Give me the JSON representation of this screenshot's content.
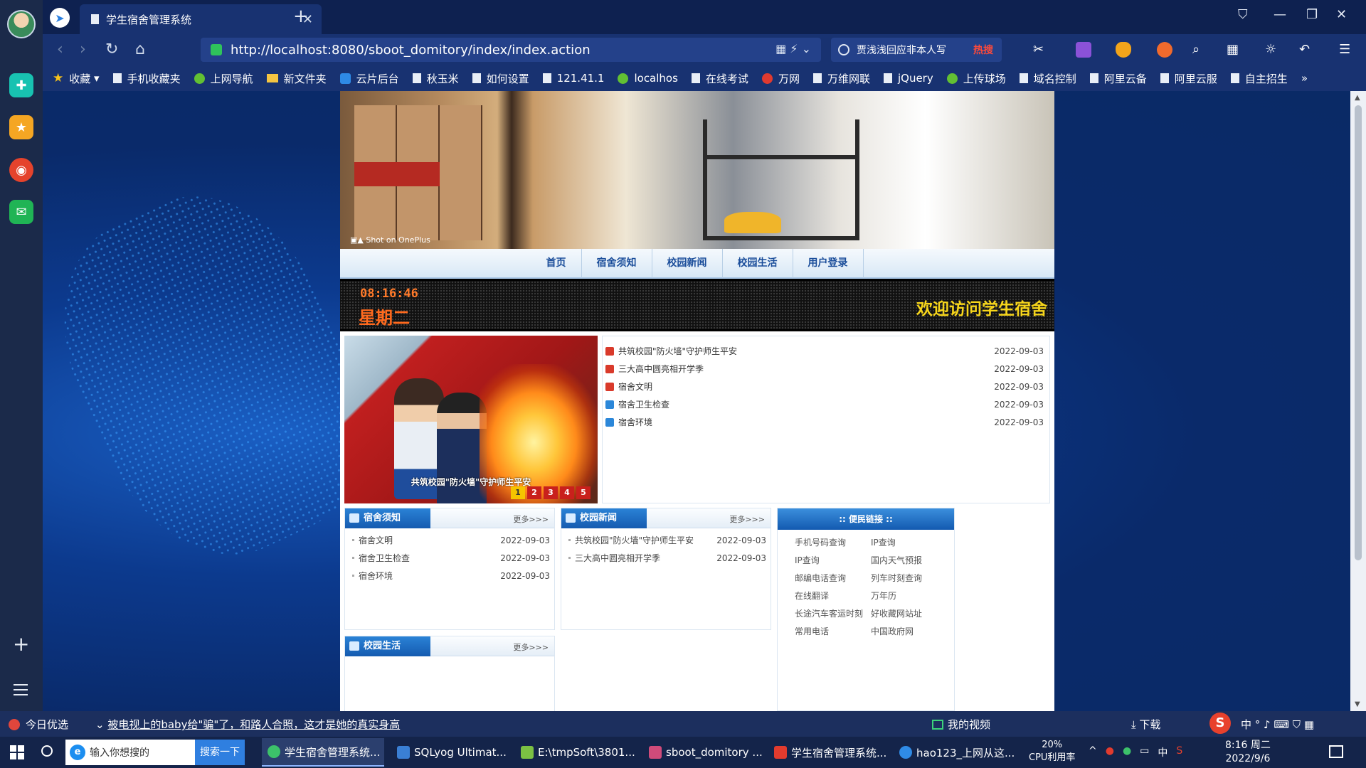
{
  "browser": {
    "tab_title": "学生宿舍管理系统",
    "url": "http://localhost:8080/sboot_domitory/index/index.action",
    "search_text": "贾浅浅回应非本人写",
    "search_hot": "热搜",
    "bookmarks": [
      "收藏",
      "手机收藏夹",
      "上网导航",
      "新文件夹",
      "云片后台",
      "秋玉米",
      "如何设置",
      "121.41.1",
      "localhos",
      "在线考试",
      "万网",
      "万维网联",
      "jQuery",
      "上传球场",
      "域名控制",
      "阿里云备",
      "阿里云服",
      "自主招生"
    ],
    "bookmarks_more": "»"
  },
  "site": {
    "nav": [
      "首页",
      "宿舍须知",
      "校园新闻",
      "校园生活",
      "用户登录"
    ],
    "clock_time": "08:16:46",
    "clock_weekday": "星期二",
    "marquee": "欢迎访问学生宿舍",
    "slider": {
      "caption": "共筑校园\"防火墙\"守护师生平安",
      "pages": [
        "1",
        "2",
        "3",
        "4",
        "5"
      ]
    },
    "top_news": [
      {
        "title": "共筑校园\"防火墙\"守护师生平安",
        "date": "2022-09-03"
      },
      {
        "title": "三大高中圆亮相开学季",
        "date": "2022-09-03"
      },
      {
        "title": "宿舍文明",
        "date": "2022-09-03"
      },
      {
        "title": "宿舍卫生检查",
        "date": "2022-09-03"
      },
      {
        "title": "宿舍环境",
        "date": "2022-09-03"
      }
    ],
    "notice_box": {
      "title": "宿舍须知",
      "more": "更多>>>",
      "items": [
        {
          "title": "宿舍文明",
          "date": "2022-09-03"
        },
        {
          "title": "宿舍卫生检查",
          "date": "2022-09-03"
        },
        {
          "title": "宿舍环境",
          "date": "2022-09-03"
        }
      ]
    },
    "news_box": {
      "title": "校园新闻",
      "more": "更多>>>",
      "items": [
        {
          "title": "共筑校园\"防火墙\"守护师生平安",
          "date": "2022-09-03"
        },
        {
          "title": "三大高中圆亮相开学季",
          "date": "2022-09-03"
        }
      ]
    },
    "life_box": {
      "title": "校园生活",
      "more": "更多>>>"
    },
    "links_box": {
      "title": ":: 便民链接 ::",
      "items": [
        "手机号码查询",
        "IP查询",
        "IP查询",
        "国内天气预报",
        "邮编电话查询",
        "列车时刻查询",
        "在线翻译",
        "万年历",
        "长途汽车客运时刻",
        "好收藏网站址",
        "常用电话",
        "中国政府网"
      ]
    }
  },
  "statusbar": {
    "today": "今日优选",
    "news": "被电视上的baby给\"骗\"了，和路人合照，这才是她的真实身高",
    "my_video": "我的视频",
    "download": "下载",
    "ime_lang": "中"
  },
  "taskbar": {
    "search_placeholder": "输入你想搜的",
    "search_button": "搜索一下",
    "tasks": [
      {
        "label": "学生宿舍管理系统...",
        "active": true
      },
      {
        "label": "SQLyog Ultimat...",
        "active": false
      },
      {
        "label": "E:\\tmpSoft\\3801...",
        "active": false
      },
      {
        "label": "sboot_domitory ...",
        "active": false
      },
      {
        "label": "学生宿舍管理系统...",
        "active": false
      },
      {
        "label": "hao123_上网从这...",
        "active": false
      }
    ],
    "cpu_value": "20%",
    "cpu_label": "CPU利用率",
    "tray_lang": "中",
    "clock_time": "8:16 周二",
    "clock_date": "2022/9/6"
  },
  "colors": {
    "nav_text": "#1a4d9a",
    "box_header": "#155bb0",
    "ticker_time": "#ff7a2a",
    "marquee": "#f7d61b",
    "slider_active": "#f5c400"
  }
}
